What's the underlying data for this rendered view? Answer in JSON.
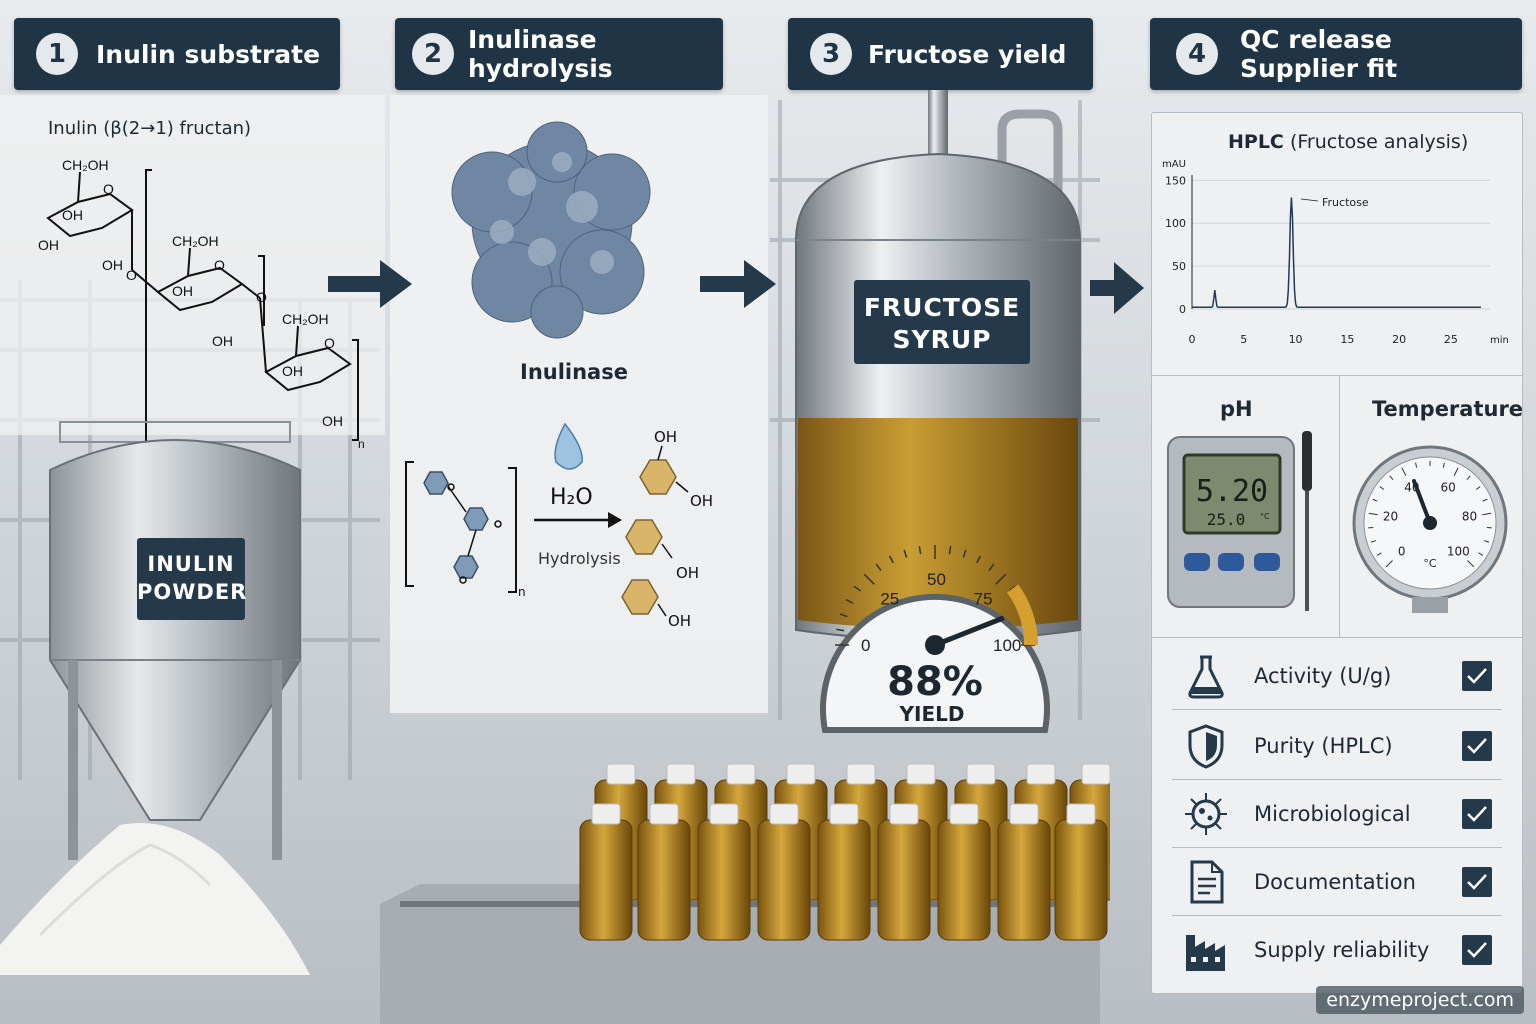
{
  "steps": [
    {
      "num": "1",
      "label": "Inulin substrate"
    },
    {
      "num": "2",
      "label": "Inulinase hydrolysis"
    },
    {
      "num": "3",
      "label": "Fructose yield"
    },
    {
      "num": "4",
      "label_line1": "QC release",
      "label_line2": "Supplier fit"
    }
  ],
  "inulin": {
    "structure_title": "Inulin (β(2→1) fructan)",
    "ring_labels": [
      "CH₂OH",
      "O",
      "OH",
      "OH",
      "OH",
      "O"
    ],
    "repeat_subscript": "n",
    "tank_line1": "INULIN",
    "tank_line2": "POWDER"
  },
  "hydrolysis": {
    "enzyme_label": "Inulinase",
    "water": "H₂O",
    "arrow_caption": "Hydrolysis",
    "repeat_subscript": "n",
    "oh": "OH"
  },
  "fructose": {
    "tank_line1": "FRUCTOSE",
    "tank_line2": "SYRUP",
    "gauge_ticks": [
      "0",
      "25",
      "50",
      "75",
      "100"
    ],
    "gauge_value": 88,
    "gauge_value_text": "88%",
    "gauge_caption": "YIELD"
  },
  "qc": {
    "hplc": {
      "title_bold": "HPLC",
      "title_rest": "(Fructose analysis)",
      "y_unit": "mAU",
      "y_ticks": [
        "150",
        "100",
        "50",
        "0"
      ],
      "x_ticks": [
        "0",
        "5",
        "10",
        "15",
        "20",
        "25"
      ],
      "x_unit": "min",
      "peak_label": "Fructose"
    },
    "ph": {
      "title": "pH",
      "reading": "5.20",
      "temp_reading": "25.0",
      "temp_unit": "°C"
    },
    "temperature": {
      "title": "Temperature",
      "dial_ticks": [
        "0",
        "20",
        "40",
        "60",
        "80",
        "100"
      ],
      "unit": "°C"
    },
    "checklist": [
      {
        "label": "Activity (U/g)",
        "icon": "flask-icon",
        "checked": true
      },
      {
        "label": "Purity (HPLC)",
        "icon": "shield-icon",
        "checked": true
      },
      {
        "label": "Microbiological",
        "icon": "microbe-icon",
        "checked": true
      },
      {
        "label": "Documentation",
        "icon": "document-icon",
        "checked": true
      },
      {
        "label": "Supply reliability",
        "icon": "factory-icon",
        "checked": true
      }
    ]
  },
  "footer": "enzymeproject.com",
  "colors": {
    "navy": "#1f3444",
    "syrup": "#b8861c",
    "hexagon_blue": "#7f9bb8",
    "hexagon_gold": "#d9b56a"
  }
}
